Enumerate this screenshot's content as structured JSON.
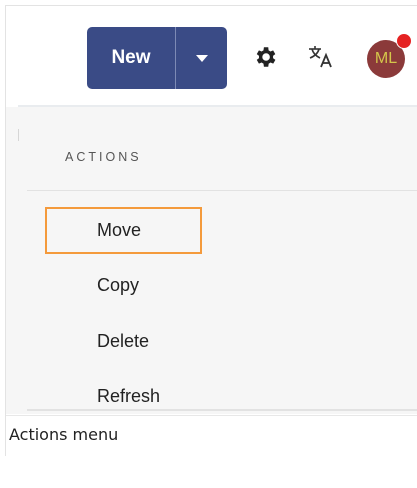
{
  "toolbar": {
    "new_label": "New",
    "dropdown_icon": "caret-down-icon",
    "settings_icon": "gear-icon",
    "language_icon": "translate-icon",
    "avatar_initials": "ML",
    "has_notification": true
  },
  "actions_menu": {
    "heading": "ACTIONS",
    "items": [
      {
        "label": "Move",
        "focused": true
      },
      {
        "label": "Copy",
        "focused": false
      },
      {
        "label": "Delete",
        "focused": false
      },
      {
        "label": "Refresh",
        "focused": false
      }
    ]
  },
  "caption": "Actions menu",
  "colors": {
    "primary_button": "#3a4b86",
    "focus_outline": "#f49a3c",
    "avatar_bg": "#8b3a3a",
    "notification_dot": "#e52222",
    "menu_bg": "#f6f6f6"
  }
}
